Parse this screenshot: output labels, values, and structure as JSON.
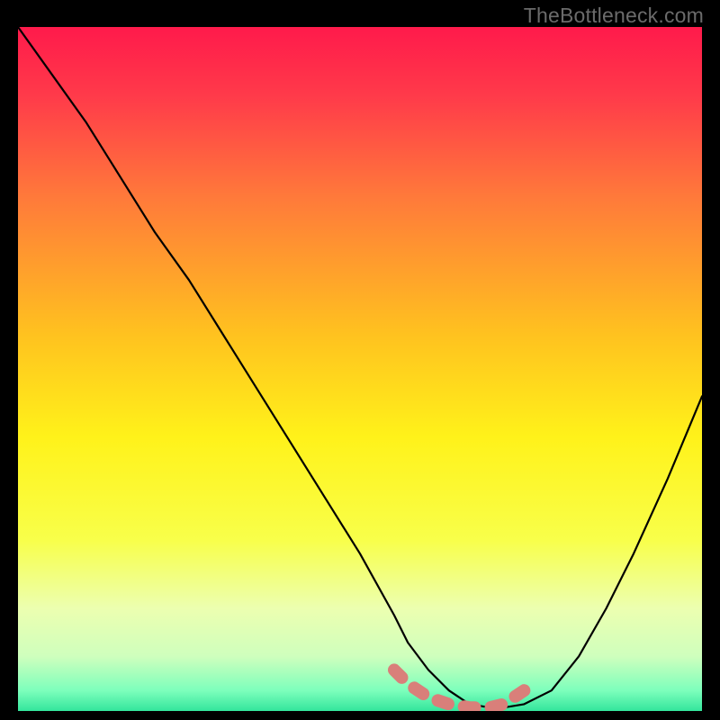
{
  "watermark": "TheBottleneck.com",
  "chart_data": {
    "type": "line",
    "title": "",
    "xlabel": "",
    "ylabel": "",
    "xlim": [
      0,
      100
    ],
    "ylim": [
      0,
      100
    ],
    "grid": false,
    "legend": false,
    "gradient_stops": [
      {
        "offset": 0,
        "color": "#ff1a4b"
      },
      {
        "offset": 10,
        "color": "#ff3a4a"
      },
      {
        "offset": 25,
        "color": "#ff7a3a"
      },
      {
        "offset": 45,
        "color": "#ffc21f"
      },
      {
        "offset": 60,
        "color": "#fff21a"
      },
      {
        "offset": 75,
        "color": "#f8ff4a"
      },
      {
        "offset": 85,
        "color": "#ecffb0"
      },
      {
        "offset": 92,
        "color": "#cfffbd"
      },
      {
        "offset": 97,
        "color": "#7dffbc"
      },
      {
        "offset": 100,
        "color": "#33e59c"
      }
    ],
    "series": [
      {
        "name": "bottleneck-curve",
        "color": "#000000",
        "x": [
          0,
          5,
          10,
          15,
          20,
          25,
          30,
          35,
          40,
          45,
          50,
          55,
          57,
          60,
          63,
          66,
          69,
          71,
          74,
          78,
          82,
          86,
          90,
          95,
          100
        ],
        "y": [
          100,
          93,
          86,
          78,
          70,
          63,
          55,
          47,
          39,
          31,
          23,
          14,
          10,
          6,
          3,
          1,
          0.5,
          0.5,
          1,
          3,
          8,
          15,
          23,
          34,
          46
        ]
      },
      {
        "name": "optimal-zone-highlight",
        "color": "#d97f7a",
        "x": [
          55,
          57,
          60,
          63,
          66,
          69,
          71,
          74
        ],
        "y": [
          6,
          4,
          2,
          1,
          0.5,
          0.5,
          1,
          3
        ]
      }
    ],
    "annotations": []
  }
}
